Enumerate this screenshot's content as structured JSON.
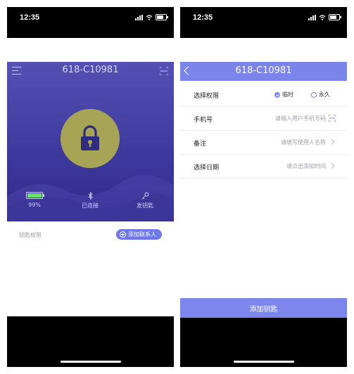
{
  "left": {
    "status_time": "12:35",
    "title": "618-C10981",
    "stats": {
      "battery_label": "99%",
      "battery_level": 0.99,
      "bluetooth_label": "已连接",
      "key_label": "发钥匙"
    },
    "permissions_label": "钥匙权限",
    "add_contact_label": "添加联系人"
  },
  "right": {
    "status_time": "12:35",
    "title": "618-C10981",
    "permission": {
      "label": "选择权限",
      "options": [
        "临时",
        "永久"
      ],
      "selected": "临时"
    },
    "phone": {
      "label": "手机号",
      "placeholder": "请输入用户手机号码"
    },
    "note": {
      "label": "备注",
      "placeholder": "请填写使用人名称"
    },
    "date": {
      "label": "选择日期",
      "placeholder": "请点击添加时间"
    },
    "add_key_label": "添加钥匙"
  },
  "colors": {
    "accent": "#7a84ea",
    "hero_top": "#5550b4",
    "hero_bottom": "#2f2a8a",
    "lock_circle": "#a8a456",
    "battery_fill": "#6be26b"
  },
  "icons": [
    "menu-icon",
    "scan-icon",
    "lock-icon",
    "battery-icon",
    "bluetooth-icon",
    "key-icon",
    "plus-circle-icon",
    "back-icon",
    "chevron-right-icon",
    "signal-icon",
    "wifi-icon"
  ]
}
